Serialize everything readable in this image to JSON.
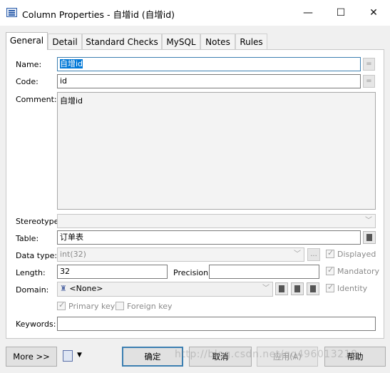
{
  "window": {
    "title": "Column Properties - 自增id (自增id)",
    "controls": {
      "minimize": "—",
      "maximize": "☐",
      "close": "✕"
    }
  },
  "tabs": [
    "General",
    "Detail",
    "Standard Checks",
    "MySQL",
    "Notes",
    "Rules"
  ],
  "form": {
    "name_label": "Name:",
    "name_value": "自增id",
    "code_label": "Code:",
    "code_value": "id",
    "equals": "=",
    "comment_label": "Comment:",
    "comment_value": "自增id",
    "stereotype_label": "Stereotype:",
    "stereotype_value": "",
    "table_label": "Table:",
    "table_value": "订单表",
    "datatype_label": "Data type:",
    "datatype_value": "int(32)",
    "ellipsis": "...",
    "displayed_label": "Displayed",
    "length_label": "Length:",
    "length_value": "32",
    "precision_label": "Precision:",
    "precision_value": "",
    "mandatory_label": "Mandatory",
    "domain_label": "Domain:",
    "domain_value": "<None>",
    "identity_label": "Identity",
    "primary_key_label": "Primary key",
    "foreign_key_label": "Foreign key",
    "keywords_label": "Keywords:",
    "keywords_value": ""
  },
  "checks": {
    "displayed": true,
    "mandatory": true,
    "identity": true,
    "primary_key": true,
    "foreign_key": false
  },
  "footer": {
    "more": "More >>",
    "ok": "确定",
    "cancel": "取消",
    "apply": "应用(A)",
    "help": "帮助"
  },
  "watermark": "http://blog.csdn.net/qq496013218",
  "colors": {
    "selection": "#0078d7",
    "focus_border": "#3c7fb1"
  }
}
